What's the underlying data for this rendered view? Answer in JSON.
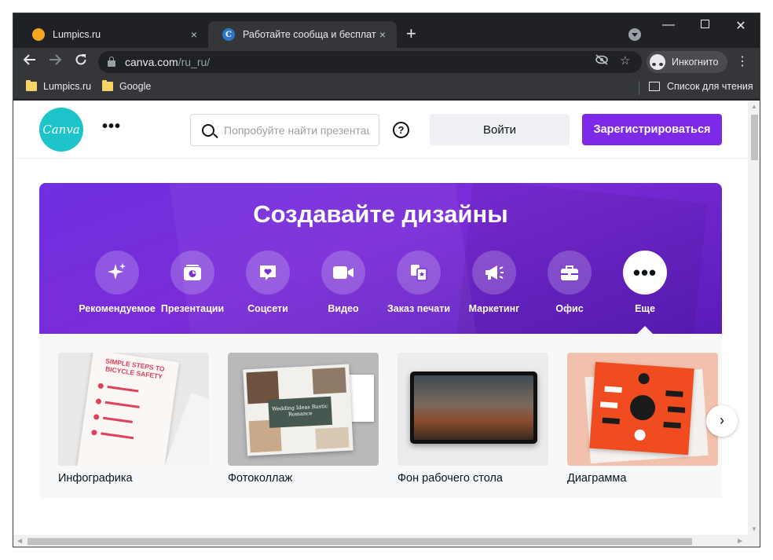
{
  "browser": {
    "tabs": [
      {
        "title": "Lumpics.ru",
        "active": false
      },
      {
        "title": "Работайте сообща и бесплатно",
        "active": true,
        "favicon_letter": "C"
      }
    ],
    "tab_close_glyph": "×",
    "new_tab_glyph": "+",
    "url_host": "canva.com",
    "url_path": "/ru_ru/",
    "incognito_label": "Инкогнито",
    "bookmarks": [
      {
        "label": "Lumpics.ru"
      },
      {
        "label": "Google"
      }
    ],
    "reading_list_label": "Список для чтения"
  },
  "header": {
    "logo_text": "Canva",
    "search_placeholder": "Попробуйте найти презентации",
    "help_glyph": "?",
    "login_label": "Войти",
    "signup_label": "Зарегистрироваться"
  },
  "hero": {
    "title": "Создавайте дизайны",
    "categories": [
      {
        "label": "Рекомендуемое",
        "icon": "sparkle-icon",
        "selected": false
      },
      {
        "label": "Презентации",
        "icon": "presentation-icon",
        "selected": false
      },
      {
        "label": "Соцсети",
        "icon": "heart-chat-icon",
        "selected": false
      },
      {
        "label": "Видео",
        "icon": "video-camera-icon",
        "selected": false
      },
      {
        "label": "Заказ печати",
        "icon": "print-icon",
        "selected": false
      },
      {
        "label": "Маркетинг",
        "icon": "megaphone-icon",
        "selected": false
      },
      {
        "label": "Офис",
        "icon": "briefcase-icon",
        "selected": false
      },
      {
        "label": "Еще",
        "icon": "more-dots-icon",
        "selected": true
      }
    ]
  },
  "gallery": {
    "cards": [
      {
        "label": "Инфографика",
        "thumb_text": "SIMPLE STEPS TO BICYCLE SAFETY"
      },
      {
        "label": "Фотоколлаж",
        "thumb_text": "Wedding Ideas Rustic Romance"
      },
      {
        "label": "Фон рабочего стола"
      },
      {
        "label": "Диаграмма"
      }
    ],
    "next_glyph": "›"
  },
  "colors": {
    "brand_purple": "#7d2ae8",
    "logo_teal": "#1dc4c9",
    "chrome_dark": "#202124",
    "chrome_toolbar": "#35363a"
  }
}
